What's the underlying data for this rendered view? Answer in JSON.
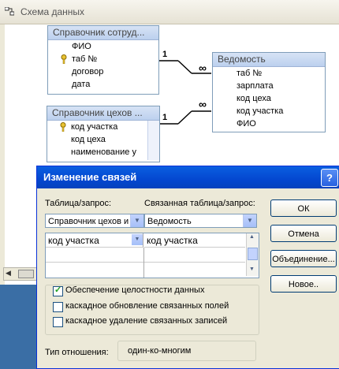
{
  "window": {
    "title": "Схема данных"
  },
  "tables": [
    {
      "title": "Справочник сотруд...",
      "fields": [
        "ФИО",
        "таб №",
        "договор",
        "дата"
      ],
      "key_field_index": 1
    },
    {
      "title": "Ведомость",
      "fields": [
        "таб №",
        "зарплата",
        "код цеха",
        "код участка",
        "ФИО"
      ]
    },
    {
      "title": "Справочник цехов ...",
      "fields": [
        "код участка",
        "код цеха",
        "наименование у"
      ],
      "key_field_index": 0
    }
  ],
  "relations": [
    {
      "one_label": "1",
      "many_label": "∞"
    },
    {
      "one_label": "1",
      "many_label": "∞"
    }
  ],
  "dialog": {
    "title": "Изменение связей",
    "help": "?",
    "table_label": "Таблица/запрос:",
    "related_label": "Связанная таблица/запрос:",
    "table_value": "Справочник цехов и",
    "related_value": "Ведомость",
    "grid_rows": [
      {
        "left": "код участка",
        "right": "код участка"
      }
    ],
    "buttons": {
      "ok": "ОК",
      "cancel": "Отмена",
      "join": "Объединение...",
      "new": "Новое.."
    },
    "checkboxes": [
      {
        "label": "Обеспечение целостности данных",
        "checked": true
      },
      {
        "label": "каскадное обновление связанных полей",
        "checked": false
      },
      {
        "label": "каскадное удаление связанных записей",
        "checked": false
      }
    ],
    "relation_type_label": "Тип отношения:",
    "relation_type_value": "один-ко-многим"
  }
}
